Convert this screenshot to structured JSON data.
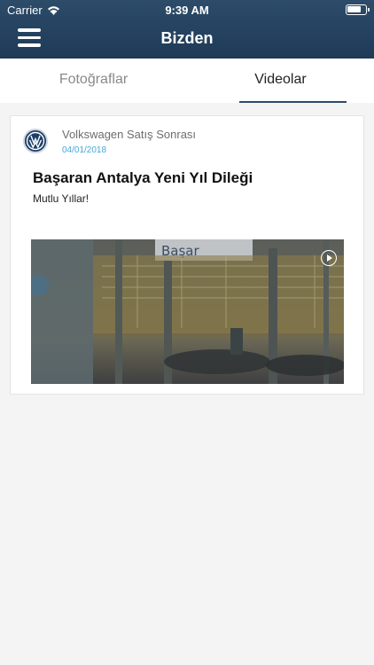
{
  "status": {
    "carrier": "Carrier",
    "time": "9:39 AM"
  },
  "header": {
    "title": "Bizden"
  },
  "tabs": [
    {
      "label": "Fotoğraflar",
      "active": false
    },
    {
      "label": "Videolar",
      "active": true
    }
  ],
  "post": {
    "author": "Volkswagen Satış Sonrası",
    "date": "04/01/2018",
    "title": "Başaran Antalya Yeni Yıl Dileği",
    "description": "Mutlu Yıllar!",
    "thumbnail_sign_text": "Başar"
  },
  "colors": {
    "header": "#2d4c6a",
    "date": "#45a8d6",
    "background": "#f4f4f4"
  }
}
